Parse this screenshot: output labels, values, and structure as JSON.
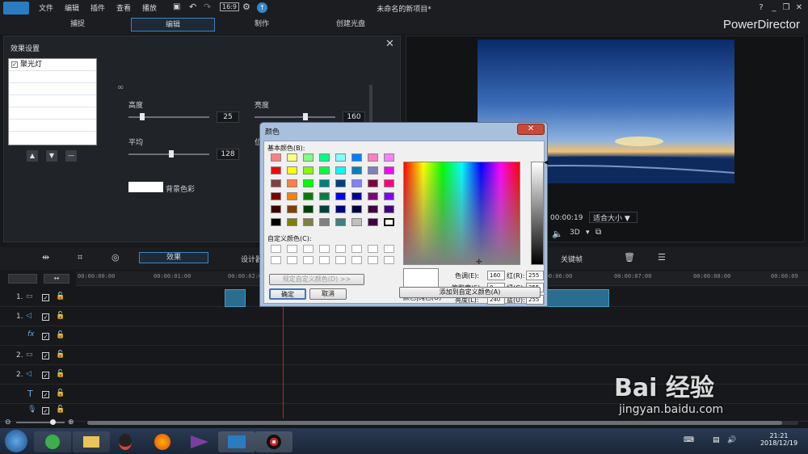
{
  "menubar": {
    "items": [
      "文件",
      "编辑",
      "插件",
      "查看",
      "播放"
    ],
    "doc_title": "未命名的新项目*",
    "help": "?"
  },
  "modes": {
    "tabs": [
      "捕捉",
      "编辑",
      "制作",
      "创建光盘"
    ],
    "active": "编辑",
    "brand": "PowerDirector"
  },
  "fx_panel": {
    "title": "效果设置",
    "effect_name": "聚光灯",
    "params": {
      "height_label": "高度",
      "height_value": "25",
      "brightness_label": "亮度",
      "brightness_value": "160",
      "avg_label": "平均",
      "avg_value": "128",
      "pos_label": "位",
      "bg_color_label": "背景色彩"
    }
  },
  "preview": {
    "timecode": "00:00:19",
    "fit_label": "适合大小",
    "mode_3d": "3D"
  },
  "edit_toolbar": {
    "effect_tab": "效果",
    "designer": "设计器",
    "keyframe": "关键帧"
  },
  "timeline": {
    "ticks": [
      "00:00:00:00",
      "00:00:01:00",
      "00:00:02:00",
      "00:00:06:00",
      "00:00:07:00",
      "00:00:08:00",
      "00:00:09"
    ],
    "tracks": [
      {
        "label": "1.",
        "icon": "video-track-icon"
      },
      {
        "label": "1.",
        "icon": "audio-track-icon"
      },
      {
        "label": "fx",
        "icon": "fx-track-icon"
      },
      {
        "label": "2.",
        "icon": "video-track-icon"
      },
      {
        "label": "2.",
        "icon": "audio-track-icon"
      },
      {
        "label": "T",
        "icon": "title-track-icon"
      },
      {
        "label": "",
        "icon": "mic-track-icon"
      }
    ]
  },
  "color_dialog": {
    "title": "颜色",
    "basic_label": "基本颜色(B):",
    "custom_label": "自定义颜色(C):",
    "define_button": "规定自定义颜色(D) >>",
    "ok": "确定",
    "cancel": "取消",
    "solid_label": "颜色|纯色(O)",
    "add_custom": "添加到自定义颜色(A)",
    "hue_label": "色调(E):",
    "hue": "160",
    "sat_label": "饱和度(S):",
    "sat": "0",
    "lum_label": "亮度(L):",
    "lum": "240",
    "red_label": "红(R):",
    "red": "255",
    "green_label": "绿(G):",
    "green": "255",
    "blue_label": "蓝(U):",
    "blue": "255",
    "basic_colors": [
      "#ff8080",
      "#ffff80",
      "#80ff80",
      "#00ff80",
      "#80ffff",
      "#0080ff",
      "#ff80c0",
      "#ff80ff",
      "#ff0000",
      "#ffff00",
      "#80ff00",
      "#00ff40",
      "#00ffff",
      "#0080c0",
      "#8080c0",
      "#ff00ff",
      "#804040",
      "#ff8040",
      "#00ff00",
      "#008080",
      "#004080",
      "#8080ff",
      "#800040",
      "#ff0080",
      "#800000",
      "#ff8000",
      "#008000",
      "#008040",
      "#0000ff",
      "#0000a0",
      "#800080",
      "#8000ff",
      "#400000",
      "#804000",
      "#004000",
      "#004040",
      "#000080",
      "#000040",
      "#400040",
      "#400080",
      "#000000",
      "#808000",
      "#808040",
      "#808080",
      "#408080",
      "#c0c0c0",
      "#400040",
      "#ffffff"
    ]
  },
  "taskbar": {
    "time": "21:21",
    "date": "2018/12/19"
  },
  "watermark": {
    "text": "Bai 经验",
    "url": "jingyan.baidu.com"
  }
}
